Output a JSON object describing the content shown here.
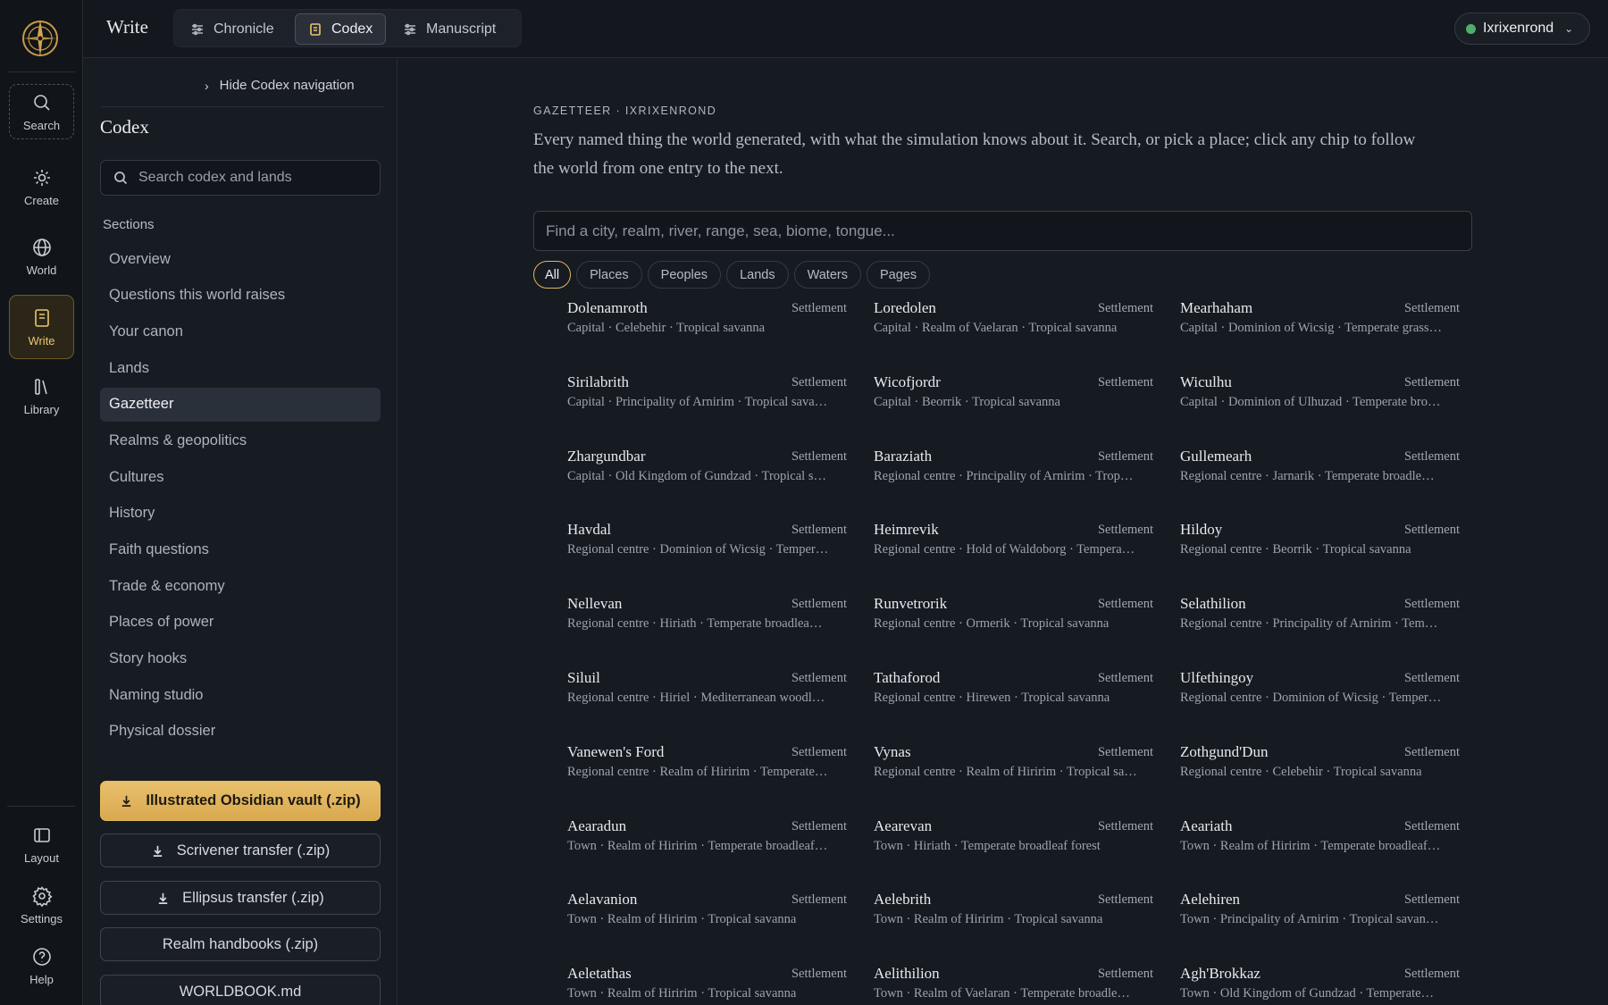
{
  "rail": {
    "top": [
      {
        "label": "Search",
        "icon": "search-icon"
      },
      {
        "label": "Create",
        "icon": "sparkle-icon"
      },
      {
        "label": "World",
        "icon": "globe-icon"
      },
      {
        "label": "Write",
        "icon": "notebook-icon"
      },
      {
        "label": "Library",
        "icon": "books-icon"
      }
    ],
    "bottom": [
      {
        "label": "Layout",
        "icon": "layout-icon"
      },
      {
        "label": "Settings",
        "icon": "gear-icon"
      },
      {
        "label": "Help",
        "icon": "help-icon"
      }
    ]
  },
  "topbar": {
    "title": "Write",
    "tabs": [
      {
        "label": "Chronicle"
      },
      {
        "label": "Codex"
      },
      {
        "label": "Manuscript"
      }
    ],
    "user": "Ixrixenrond"
  },
  "sidebar": {
    "hide_label": "Hide Codex navigation",
    "title": "Codex",
    "search_placeholder": "Search codex and lands",
    "sections_label": "Sections",
    "items": [
      "Overview",
      "Questions this world raises",
      "Your canon",
      "Lands",
      "Gazetteer",
      "Realms & geopolitics",
      "Cultures",
      "History",
      "Faith questions",
      "Trade & economy",
      "Places of power",
      "Story hooks",
      "Naming studio",
      "Physical dossier"
    ],
    "downloads": [
      "Illustrated Obsidian vault (.zip)",
      "Scrivener transfer (.zip)",
      "Ellipsus transfer (.zip)",
      "Realm handbooks (.zip)",
      "WORLDBOOK.md"
    ]
  },
  "main": {
    "eyebrow": "GAZETTEER · IXRIXENROND",
    "intro": "Every named thing the world generated, with what the simulation knows about it. Search, or pick a place; click any chip to follow the world from one entry to the next.",
    "search_placeholder": "Find a city, realm, river, range, sea, biome, tongue...",
    "filters": [
      "All",
      "Places",
      "Peoples",
      "Lands",
      "Waters",
      "Pages"
    ],
    "active_filter": "All",
    "entries": [
      {
        "name": "Dolenamroth",
        "kind": "Settlement",
        "meta": "Capital · Celebehir · Tropical savanna"
      },
      {
        "name": "Loredolen",
        "kind": "Settlement",
        "meta": "Capital · Realm of Vaelaran · Tropical savanna"
      },
      {
        "name": "Mearhaham",
        "kind": "Settlement",
        "meta": "Capital · Dominion of Wicsig · Temperate grass…"
      },
      {
        "name": "Sirilabrith",
        "kind": "Settlement",
        "meta": "Capital · Principality of Arnirim · Tropical sava…"
      },
      {
        "name": "Wicofjordr",
        "kind": "Settlement",
        "meta": "Capital · Beorrik · Tropical savanna"
      },
      {
        "name": "Wiculhu",
        "kind": "Settlement",
        "meta": "Capital · Dominion of Ulhuzad · Temperate bro…"
      },
      {
        "name": "Zhargundbar",
        "kind": "Settlement",
        "meta": "Capital · Old Kingdom of Gundzad · Tropical s…"
      },
      {
        "name": "Baraziath",
        "kind": "Settlement",
        "meta": "Regional centre · Principality of Arnirim · Trop…"
      },
      {
        "name": "Gullemearh",
        "kind": "Settlement",
        "meta": "Regional centre · Jarnarik · Temperate broadle…"
      },
      {
        "name": "Havdal",
        "kind": "Settlement",
        "meta": "Regional centre · Dominion of Wicsig · Temper…"
      },
      {
        "name": "Heimrevik",
        "kind": "Settlement",
        "meta": "Regional centre · Hold of Waldoborg · Tempera…"
      },
      {
        "name": "Hildoy",
        "kind": "Settlement",
        "meta": "Regional centre · Beorrik · Tropical savanna"
      },
      {
        "name": "Nellevan",
        "kind": "Settlement",
        "meta": "Regional centre · Hiriath · Temperate broadlea…"
      },
      {
        "name": "Runvetrorik",
        "kind": "Settlement",
        "meta": "Regional centre · Ormerik · Tropical savanna"
      },
      {
        "name": "Selathilion",
        "kind": "Settlement",
        "meta": "Regional centre · Principality of Arnirim · Tem…"
      },
      {
        "name": "Siluil",
        "kind": "Settlement",
        "meta": "Regional centre · Hiriel · Mediterranean woodl…"
      },
      {
        "name": "Tathaforod",
        "kind": "Settlement",
        "meta": "Regional centre · Hirewen · Tropical savanna"
      },
      {
        "name": "Ulfethingoy",
        "kind": "Settlement",
        "meta": "Regional centre · Dominion of Wicsig · Temper…"
      },
      {
        "name": "Vanewen's Ford",
        "kind": "Settlement",
        "meta": "Regional centre · Realm of Hiririm · Temperate…"
      },
      {
        "name": "Vynas",
        "kind": "Settlement",
        "meta": "Regional centre · Realm of Hiririm · Tropical sa…"
      },
      {
        "name": "Zothgund'Dun",
        "kind": "Settlement",
        "meta": "Regional centre · Celebehir · Tropical savanna"
      },
      {
        "name": "Aearadun",
        "kind": "Settlement",
        "meta": "Town · Realm of Hiririm · Temperate broadleaf…"
      },
      {
        "name": "Aearevan",
        "kind": "Settlement",
        "meta": "Town · Hiriath · Temperate broadleaf forest"
      },
      {
        "name": "Aeariath",
        "kind": "Settlement",
        "meta": "Town · Realm of Hiririm · Temperate broadleaf…"
      },
      {
        "name": "Aelavanion",
        "kind": "Settlement",
        "meta": "Town · Realm of Hiririm · Tropical savanna"
      },
      {
        "name": "Aelebrith",
        "kind": "Settlement",
        "meta": "Town · Realm of Hiririm · Tropical savanna"
      },
      {
        "name": "Aelehiren",
        "kind": "Settlement",
        "meta": "Town · Principality of Arnirim · Tropical savan…"
      },
      {
        "name": "Aeletathas",
        "kind": "Settlement",
        "meta": "Town · Realm of Hiririm · Tropical savanna"
      },
      {
        "name": "Aelithilion",
        "kind": "Settlement",
        "meta": "Town · Realm of Vaelaran · Temperate broadle…"
      },
      {
        "name": "Agh'Brokkaz",
        "kind": "Settlement",
        "meta": "Town · Old Kingdom of Gundzad · Temperate…"
      }
    ]
  },
  "colors": {
    "accent": "#e0b85f",
    "status_online": "#4fae6b",
    "background": "#161a21"
  }
}
